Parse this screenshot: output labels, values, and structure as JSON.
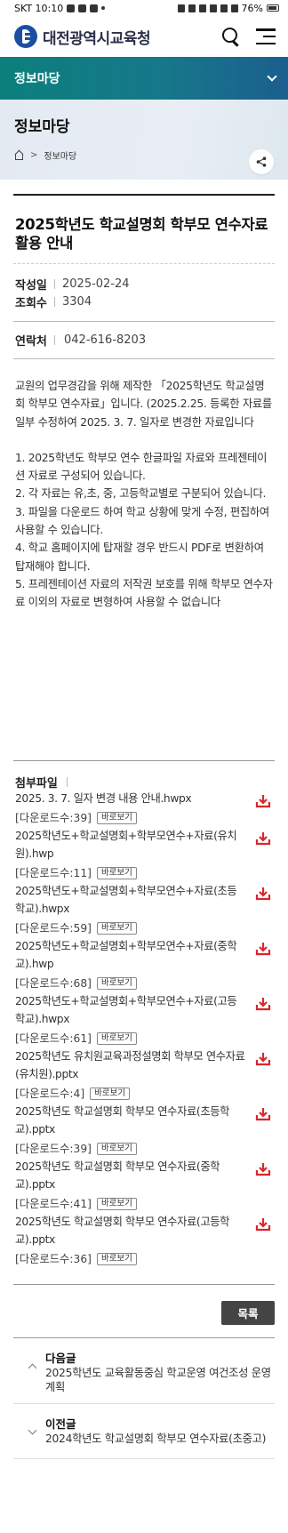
{
  "status": {
    "time": "SKT 10:10",
    "battery": "76%"
  },
  "header": {
    "logo_text": "대전광역시교육청"
  },
  "section": {
    "label": "정보마당"
  },
  "page": {
    "title": "정보마당",
    "breadcrumb": [
      "정보마당"
    ]
  },
  "article": {
    "title": "2025학년도 학교설명회 학부모 연수자료 활용 안내",
    "meta": [
      {
        "key": "작성일",
        "value": "2025-02-24"
      },
      {
        "key": "조회수",
        "value": "3304"
      }
    ],
    "contact": {
      "key": "연락처",
      "value": "042-616-8203"
    },
    "body": {
      "intro": "교원의 업무경감을 위해 제작한 「2025학년도 학교설명회 학부모 연수자료」입니다. (2025.2.25. 등록한 자료를 일부 수정하여 2025. 3. 7. 일자로 변경한 자료입니다",
      "points": [
        "1. 2025학년도 학부모 연수 한글파일 자료와 프레젠테이션 자료로 구성되어 있습니다.",
        "2. 각 자료는 유,초, 중, 고등학교별로 구분되어 있습니다.",
        "3. 파일을 다운로드 하여 학교 상황에 맞게 수정, 편집하여 사용할 수 있습니다.",
        "4. 학교 홈페이지에 탑재할 경우 반드시 PDF로 변환하여 탑재해야 합니다.",
        "5. 프레젠테이션 자료의 저작권 보호를 위해 학부모 연수자료 이외의 자료로 변형하여 사용할 수 없습니다"
      ]
    }
  },
  "attachments": {
    "label": "첨부파일",
    "view_label": "바로보기",
    "items": [
      {
        "name": "2025. 3. 7. 일자 변경 내용 안내.hwpx",
        "downloads": "[다운로드수:39]"
      },
      {
        "name": "2025학년도+학교설명회+학부모연수+자료(유치원).hwp",
        "downloads": "[다운로드수:11]"
      },
      {
        "name": "2025학년도+학교설명회+학부모연수+자료(초등학교).hwpx",
        "downloads": "[다운로드수:59]"
      },
      {
        "name": "2025학년도+학교설명회+학부모연수+자료(중학교).hwp",
        "downloads": "[다운로드수:68]"
      },
      {
        "name": "2025학년도+학교설명회+학부모연수+자료(고등학교).hwpx",
        "downloads": "[다운로드수:61]"
      },
      {
        "name": "2025학년도 유치원교육과정설명회 학부모 연수자료(유치원).pptx",
        "downloads": "[다운로드수:4]"
      },
      {
        "name": "2025학년도 학교설명회 학부모 연수자료(초등학교).pptx",
        "downloads": "[다운로드수:39]"
      },
      {
        "name": "2025학년도 학교설명회 학부모 연수자료(중학교).pptx",
        "downloads": "[다운로드수:41]"
      },
      {
        "name": "2025학년도 학교설명회 학부모 연수자료(고등학교).pptx",
        "downloads": "[다운로드수:36]"
      }
    ]
  },
  "actions": {
    "list_label": "목록"
  },
  "nav": {
    "next": {
      "label": "다음글",
      "title": "2025학년도 교육활동중심 학교운영 여건조성 운영계획"
    },
    "prev": {
      "label": "이전글",
      "title": "2024학년도 학교설명회 학부모 연수자료(초중고)"
    }
  },
  "colors": {
    "accent": "#0c7f7d",
    "download": "#d9262c"
  }
}
